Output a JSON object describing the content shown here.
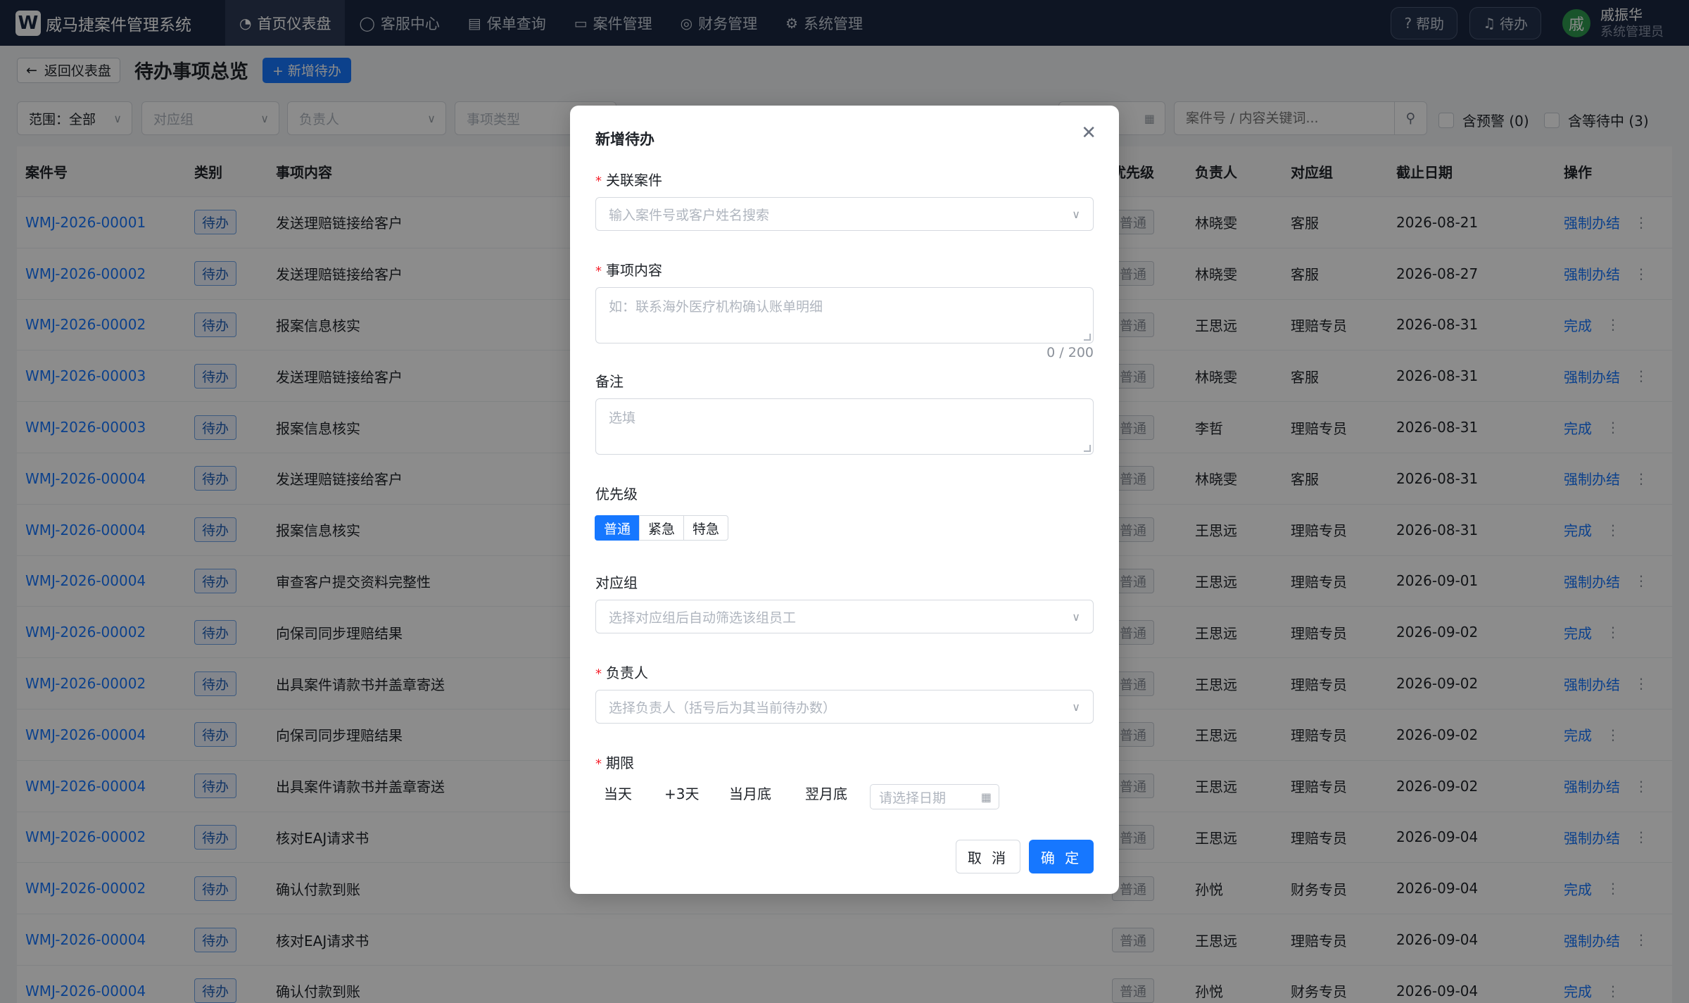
{
  "app": {
    "logo_letter": "W",
    "name": "威马捷案件管理系统"
  },
  "nav": [
    {
      "label": "首页仪表盘",
      "icon": "dashboard-icon",
      "glyph": "◔"
    },
    {
      "label": "客服中心",
      "icon": "chat-icon",
      "glyph": "◯"
    },
    {
      "label": "保单查询",
      "icon": "document-icon",
      "glyph": "▤"
    },
    {
      "label": "案件管理",
      "icon": "folder-icon",
      "glyph": "▭"
    },
    {
      "label": "财务管理",
      "icon": "finance-icon",
      "glyph": "◎"
    },
    {
      "label": "系统管理",
      "icon": "gear-icon",
      "glyph": "⚙"
    }
  ],
  "topbar": {
    "help_label": "帮助",
    "todo_label": "待办",
    "user_avatar": "戚",
    "user_name": "戚振华",
    "user_role": "系统管理员"
  },
  "page": {
    "back_label": "返回仪表盘",
    "title": "待办事项总览",
    "add_label": "+ 新增待办"
  },
  "filters": {
    "scope": "范围：全部",
    "group_placeholder": "对应组",
    "owner_placeholder": "负责人",
    "type_placeholder": "事项类型",
    "search_placeholder": "案件号 / 内容关键词...",
    "warn_label": "含预警 (0)",
    "waiting_label": "含等待中 (3)"
  },
  "table": {
    "headers": {
      "case_no": "案件号",
      "category": "类别",
      "content": "事项内容",
      "priority": "优先级",
      "owner": "负责人",
      "group": "对应组",
      "deadline": "截止日期",
      "action": "操作"
    },
    "rows": [
      {
        "case_no": "WMJ-2026-00001",
        "category": "待办",
        "content": "发送理赔链接给客户",
        "priority": "普通",
        "owner": "林晓雯",
        "group": "客服",
        "deadline": "2026-08-21",
        "action": "强制办结"
      },
      {
        "case_no": "WMJ-2026-00002",
        "category": "待办",
        "content": "发送理赔链接给客户",
        "priority": "普通",
        "owner": "林晓雯",
        "group": "客服",
        "deadline": "2026-08-27",
        "action": "强制办结"
      },
      {
        "case_no": "WMJ-2026-00002",
        "category": "待办",
        "content": "报案信息核实",
        "priority": "普通",
        "owner": "王思远",
        "group": "理赔专员",
        "deadline": "2026-08-31",
        "action": "完成"
      },
      {
        "case_no": "WMJ-2026-00003",
        "category": "待办",
        "content": "发送理赔链接给客户",
        "priority": "普通",
        "owner": "林晓雯",
        "group": "客服",
        "deadline": "2026-08-31",
        "action": "强制办结"
      },
      {
        "case_no": "WMJ-2026-00003",
        "category": "待办",
        "content": "报案信息核实",
        "priority": "普通",
        "owner": "李哲",
        "group": "理赔专员",
        "deadline": "2026-08-31",
        "action": "完成"
      },
      {
        "case_no": "WMJ-2026-00004",
        "category": "待办",
        "content": "发送理赔链接给客户",
        "priority": "普通",
        "owner": "林晓雯",
        "group": "客服",
        "deadline": "2026-08-31",
        "action": "强制办结"
      },
      {
        "case_no": "WMJ-2026-00004",
        "category": "待办",
        "content": "报案信息核实",
        "priority": "普通",
        "owner": "王思远",
        "group": "理赔专员",
        "deadline": "2026-08-31",
        "action": "完成"
      },
      {
        "case_no": "WMJ-2026-00004",
        "category": "待办",
        "content": "审查客户提交资料完整性",
        "priority": "普通",
        "owner": "王思远",
        "group": "理赔专员",
        "deadline": "2026-09-01",
        "action": "强制办结"
      },
      {
        "case_no": "WMJ-2026-00002",
        "category": "待办",
        "content": "向保司同步理赔结果",
        "priority": "普通",
        "owner": "王思远",
        "group": "理赔专员",
        "deadline": "2026-09-02",
        "action": "完成"
      },
      {
        "case_no": "WMJ-2026-00002",
        "category": "待办",
        "content": "出具案件请款书并盖章寄送",
        "priority": "普通",
        "owner": "王思远",
        "group": "理赔专员",
        "deadline": "2026-09-02",
        "action": "强制办结"
      },
      {
        "case_no": "WMJ-2026-00004",
        "category": "待办",
        "content": "向保司同步理赔结果",
        "priority": "普通",
        "owner": "王思远",
        "group": "理赔专员",
        "deadline": "2026-09-02",
        "action": "完成"
      },
      {
        "case_no": "WMJ-2026-00004",
        "category": "待办",
        "content": "出具案件请款书并盖章寄送",
        "priority": "普通",
        "owner": "王思远",
        "group": "理赔专员",
        "deadline": "2026-09-02",
        "action": "强制办结"
      },
      {
        "case_no": "WMJ-2026-00002",
        "category": "待办",
        "content": "核对EAJ请求书",
        "priority": "普通",
        "owner": "王思远",
        "group": "理赔专员",
        "deadline": "2026-09-04",
        "action": "强制办结"
      },
      {
        "case_no": "WMJ-2026-00002",
        "category": "待办",
        "content": "确认付款到账",
        "priority": "普通",
        "owner": "孙悦",
        "group": "财务专员",
        "deadline": "2026-09-04",
        "action": "完成"
      },
      {
        "case_no": "WMJ-2026-00004",
        "category": "待办",
        "content": "核对EAJ请求书",
        "priority": "普通",
        "owner": "王思远",
        "group": "理赔专员",
        "deadline": "2026-09-04",
        "action": "强制办结"
      },
      {
        "case_no": "WMJ-2026-00004",
        "category": "待办",
        "content": "确认付款到账",
        "priority": "普通",
        "owner": "孙悦",
        "group": "财务专员",
        "deadline": "2026-09-04",
        "action": "完成"
      }
    ]
  },
  "modal": {
    "title": "新增待办",
    "case_label": "关联案件",
    "case_placeholder": "输入案件号或客户姓名搜索",
    "content_label": "事项内容",
    "content_placeholder": "如：联系海外医疗机构确认账单明细",
    "content_counter": "0 / 200",
    "note_label": "备注",
    "note_placeholder": "选填",
    "priority_label": "优先级",
    "priority_options": [
      "普通",
      "紧急",
      "特急"
    ],
    "priority_selected": "普通",
    "group_label": "对应组",
    "group_placeholder": "选择对应组后自动筛选该组员工",
    "owner_label": "负责人",
    "owner_placeholder": "选择负责人（括号后为其当前待办数）",
    "deadline_label": "期限",
    "quick_dates": [
      "当天",
      "+3天",
      "当月底",
      "翌月底"
    ],
    "date_placeholder": "请选择日期",
    "cancel_label": "取 消",
    "ok_label": "确 定"
  }
}
